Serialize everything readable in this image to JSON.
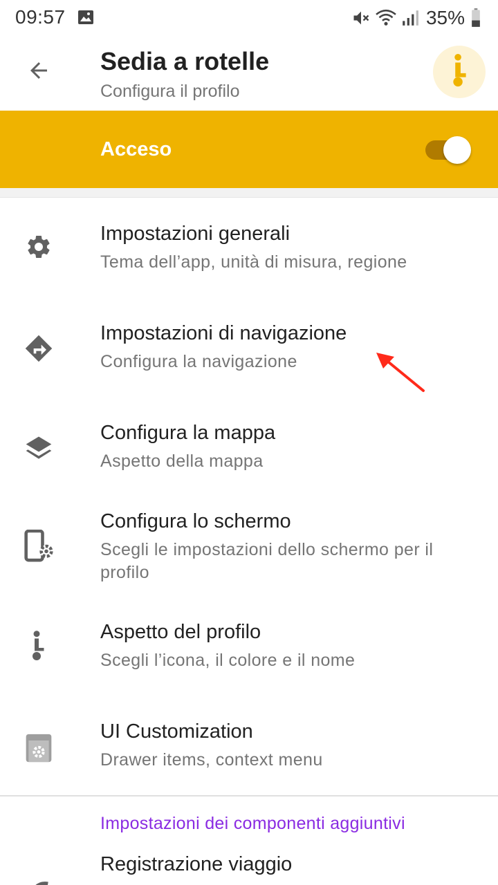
{
  "status_bar": {
    "time": "09:57",
    "battery_percent": "35%",
    "icons": [
      "image-icon",
      "mute-icon",
      "wifi-icon",
      "signal-icon",
      "battery-icon"
    ]
  },
  "header": {
    "title": "Sedia a rotelle",
    "subtitle": "Configura il profilo",
    "profile_icon": "wheelchair-profile-icon",
    "accent_color": "#efb300"
  },
  "enable_bar": {
    "label": "Acceso",
    "toggle_on": true
  },
  "settings": [
    {
      "title": "Impostazioni generali",
      "desc": "Tema dell’app, unità di misura, regione",
      "icon": "gear-icon"
    },
    {
      "title": "Impostazioni di navigazione",
      "desc": "Configura la navigazione",
      "icon": "navigation-diamond-icon"
    },
    {
      "title": "Configura la mappa",
      "desc": "Aspetto della mappa",
      "icon": "layers-icon"
    },
    {
      "title": "Configura lo schermo",
      "desc": "Scegli le impostazioni dello schermo per il profilo",
      "icon": "screen-settings-icon"
    },
    {
      "title": "Aspetto del profilo",
      "desc": "Scegli l’icona, il colore e il nome",
      "icon": "profile-figure-icon"
    },
    {
      "title": "UI Customization",
      "desc": "Drawer items, context menu",
      "icon": "ui-customization-icon"
    }
  ],
  "plugins": {
    "header": "Impostazioni dei componenti aggiuntivi",
    "items": [
      {
        "title": "Registrazione viaggio"
      }
    ]
  }
}
